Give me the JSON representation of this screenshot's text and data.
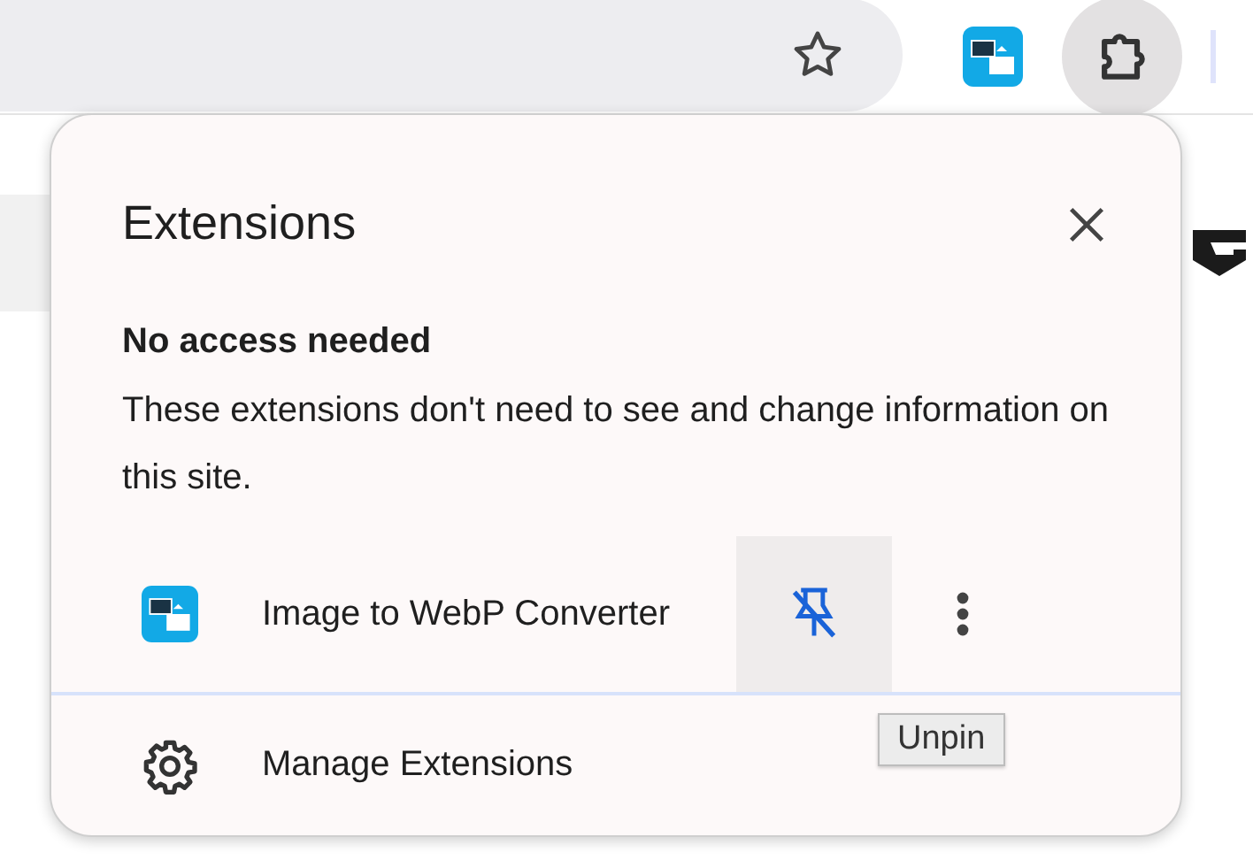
{
  "toolbar": {
    "bookmarked": false,
    "extensions_open": true
  },
  "popup": {
    "title": "Extensions",
    "section": {
      "heading": "No access needed",
      "description": "These extensions don't need to see and change information on this site."
    },
    "extensions": [
      {
        "name": "Image to WebP Converter",
        "pinned": true
      }
    ],
    "tooltip": "Unpin",
    "manage_label": "Manage Extensions"
  }
}
